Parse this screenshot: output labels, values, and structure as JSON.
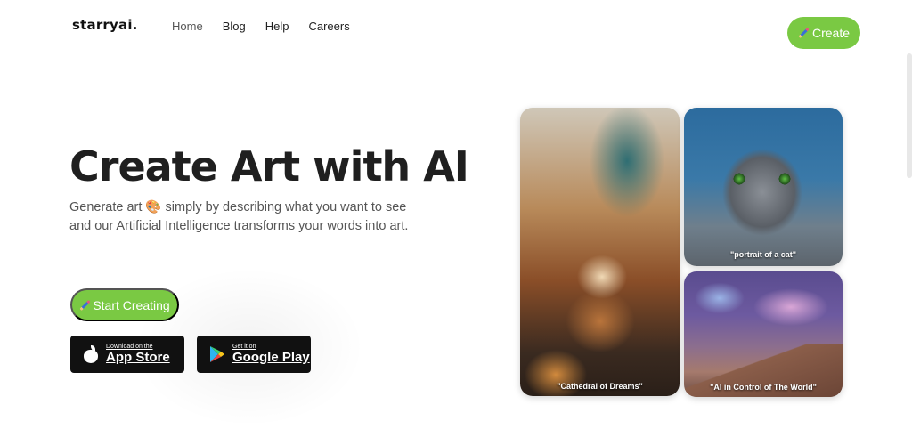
{
  "header": {
    "logo": "starryai",
    "nav": [
      "Home",
      "Blog",
      "Help",
      "Careers"
    ],
    "create_label": "Create"
  },
  "hero": {
    "title": "Create Art with AI",
    "subtitle": "Generate art 🎨 simply by describing what you want to see and our Artificial Intelligence transforms your words into art.",
    "start_label": "Start Creating"
  },
  "stores": {
    "apple_small": "Download on the",
    "apple_big": "App Store",
    "google_small": "Get it on",
    "google_big": "Google Play"
  },
  "gallery": {
    "cathedral_caption": "\"Cathedral of Dreams\"",
    "cat_caption": "\"portrait of a cat\"",
    "space_caption": "\"AI in Control of The World\""
  },
  "colors": {
    "accent": "#7ac943",
    "dark": "#111111"
  }
}
